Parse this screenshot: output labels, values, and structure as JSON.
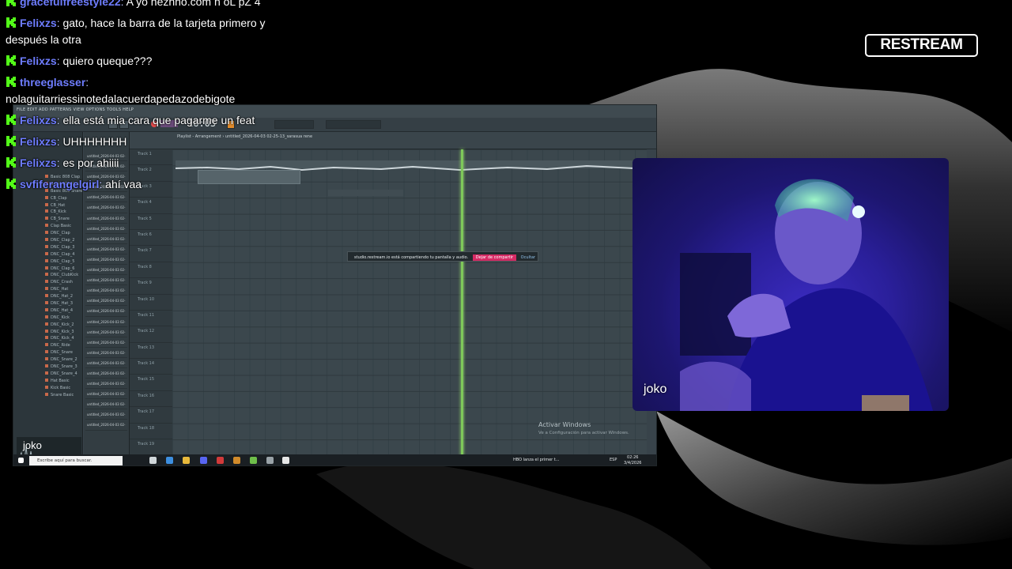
{
  "overlay": {
    "logo_text": "RESTREAM",
    "webcam_name": "joko",
    "share_owner": "joko"
  },
  "chat": [
    {
      "user": "gracefulfreestyle22",
      "text": "A yo nezhno.com n oL pZ 4",
      "color": "purple"
    },
    {
      "user": "Felixzs",
      "text": "gato, hace la barra de la tarjeta primero y después la otra",
      "color": "purple"
    },
    {
      "user": "Felixzs",
      "text": "quiero queque???",
      "color": "purple"
    },
    {
      "user": "threeglasser",
      "text": "nolaguitarriessinotedalacuerdapedazodebigote",
      "color": "purple"
    },
    {
      "user": "Felixzs",
      "text": "ella está mia cara que pagarme un feat",
      "color": "purple"
    },
    {
      "user": "Felixzs",
      "text": "UHHHHHHH",
      "color": "purple"
    },
    {
      "user": "Felixzs",
      "text": "es por ahiiii",
      "color": "purple"
    },
    {
      "user": "svfiferangelgirl",
      "text": "ahí vaa",
      "color": "purple"
    }
  ],
  "screen": {
    "menu": "FILE EDIT ADD PATTERNS VIEW OPTIONS TOOLS HELP",
    "time": "16:03",
    "playlist_title": "Playlist - Arrangement › untitled_2026-04-03 02-25-13_sarasua rene",
    "browser_items": [
      "Basic 808 Clap",
      "Basic 808 Kick",
      "Basic 808 Snare",
      "CB_Clap",
      "CB_Hat",
      "CB_Kick",
      "CB_Snare",
      "Clap Basic",
      "DNC_Clap",
      "DNC_Clap_2",
      "DNC_Clap_3",
      "DNC_Clap_4",
      "DNC_Clap_5",
      "DNC_Clap_6",
      "DNC_ClubKick",
      "DNC_Crash",
      "DNC_Hat",
      "DNC_Hat_2",
      "DNC_Hat_3",
      "DNC_Hat_4",
      "DNC_Kick",
      "DNC_Kick_2",
      "DNC_Kick_3",
      "DNC_Kick_4",
      "DNC_Ride",
      "DNC_Snare",
      "DNC_Snare_2",
      "DNC_Snare_3",
      "DNC_Snare_4",
      "Hat Basic",
      "Kick Basic",
      "Snare Basic"
    ],
    "rack_item": "untitled_2026-04-03 02-",
    "track_labels": [
      "Track 1",
      "Track 2",
      "Track 3",
      "Track 4",
      "Track 5",
      "Track 6",
      "Track 7",
      "Track 8",
      "Track 9",
      "Track 10",
      "Track 11",
      "Track 12",
      "Track 13",
      "Track 14",
      "Track 15",
      "Track 16",
      "Track 17",
      "Track 18",
      "Track 19"
    ],
    "share_notice": "studio.restream.io está compartiendo tu pantalla y audio.",
    "share_stop": "Dejar de compartir",
    "share_hide": "Ocultar",
    "activate_title": "Activar Windows",
    "activate_sub": "Ve a Configuración para activar Windows.",
    "taskbar_search": "Escribe aquí para buscar.",
    "tray_text": "HBO lanza el primer t...",
    "clock_time": "02:26",
    "clock_date": "3/4/2026",
    "lang": "ESP"
  }
}
